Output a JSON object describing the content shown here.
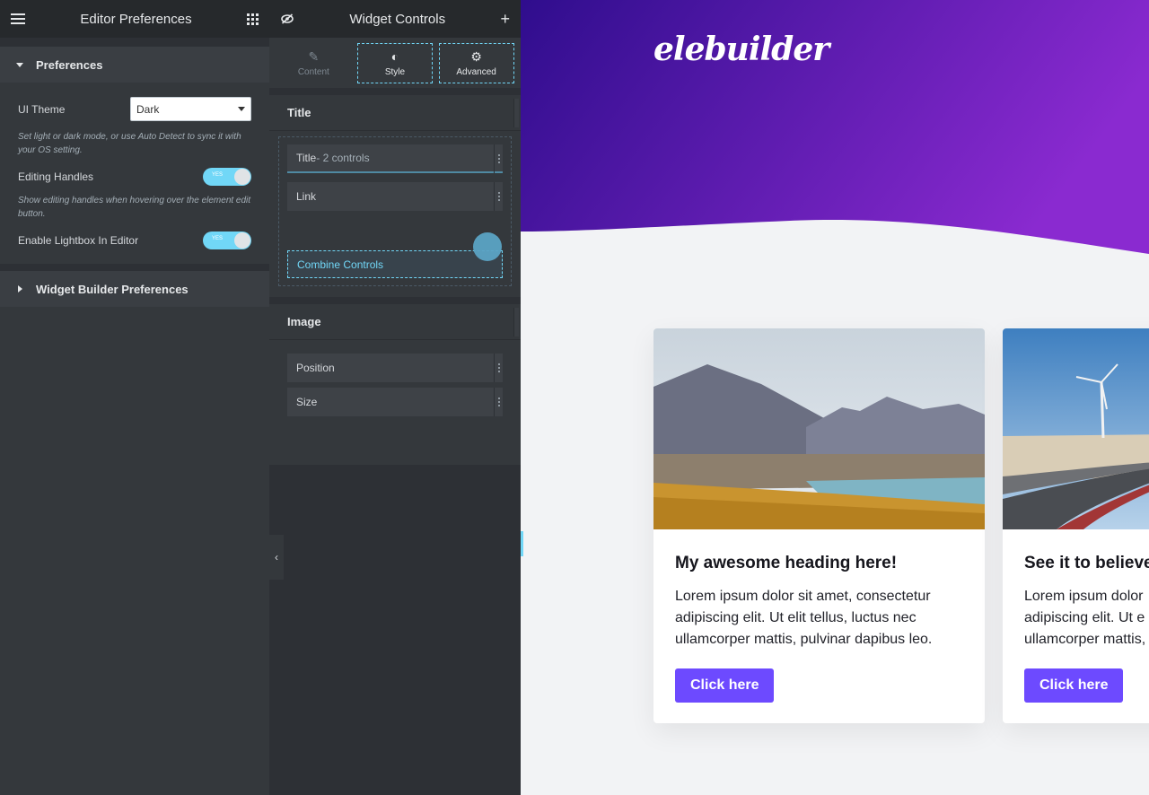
{
  "left_panel": {
    "title": "Editor Preferences",
    "preferences_section": "Preferences",
    "ui_theme_label": "UI Theme",
    "ui_theme_value": "Dark",
    "ui_theme_desc": "Set light or dark mode, or use Auto Detect to sync it with your OS setting.",
    "editing_handles_label": "Editing Handles",
    "editing_handles_toggle": "YES",
    "editing_handles_desc": "Show editing handles when hovering over the element edit button.",
    "lightbox_label": "Enable Lightbox In Editor",
    "lightbox_toggle": "YES",
    "widget_builder_section": "Widget Builder Preferences"
  },
  "mid_panel": {
    "title": "Widget Controls",
    "tabs": {
      "content": "Content",
      "style": "Style",
      "advanced": "Advanced"
    },
    "title_section": "Title",
    "title_item_main": "Title",
    "title_item_sub": "- 2 controls",
    "link_item": "Link",
    "combine_controls": "Combine Controls",
    "image_section": "Image",
    "position_item": "Position",
    "size_item": "Size"
  },
  "preview": {
    "logo": "elebuilder",
    "accent_color": "#6d4aff",
    "hero_colors": [
      "#2f0d8d",
      "#8a2ad0"
    ],
    "cards": [
      {
        "heading": "My awesome heading here!",
        "text": "Lorem ipsum dolor sit amet, consectetur adipiscing elit. Ut elit tellus, luctus nec ullamcorper mattis, pulvinar dapibus leo.",
        "button": "Click here"
      },
      {
        "heading": "See it to believe",
        "text": "Lorem ipsum dolor adipiscing elit. Ut e ullamcorper mattis,",
        "button": "Click here"
      }
    ]
  }
}
